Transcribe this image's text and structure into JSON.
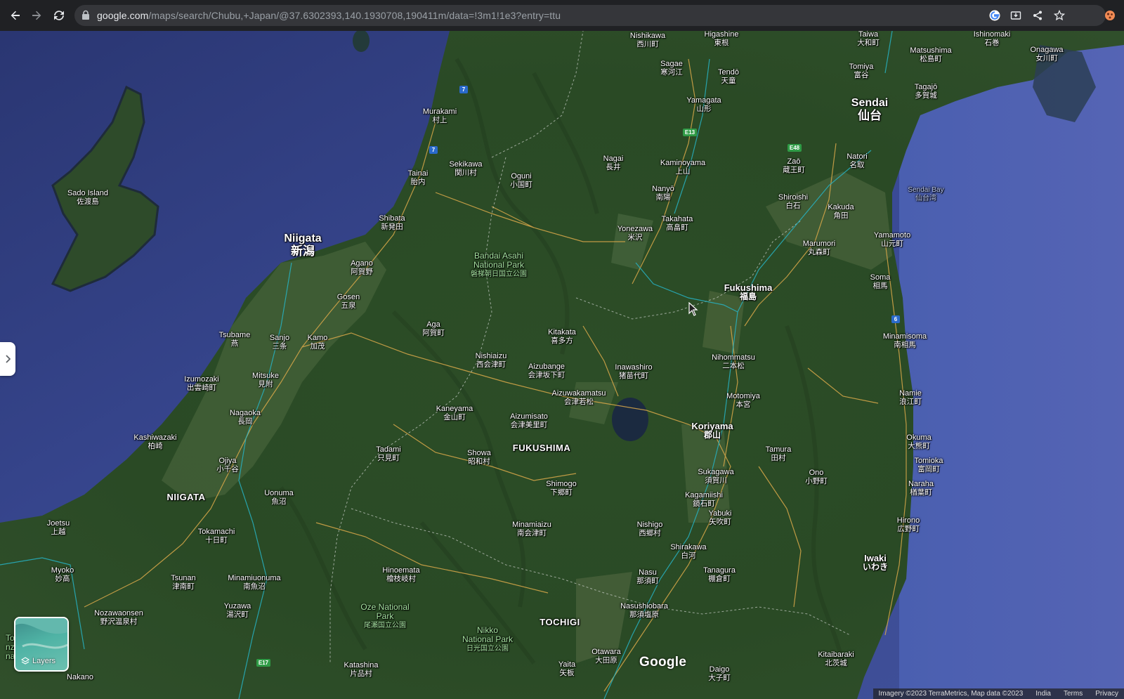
{
  "browser": {
    "url_host": "google.com",
    "url_path": "/maps/search/Chubu,+Japan/@37.6302393,140.1930708,190411m/data=!3m1!1e3?entry=ttu",
    "icons": [
      "back-arrow-icon",
      "forward-arrow-icon",
      "reload-icon",
      "lock-icon",
      "google-g-icon",
      "install-app-icon",
      "share-icon",
      "bookmark-star-icon",
      "extension-icon"
    ]
  },
  "map": {
    "cities": [
      {
        "id": "niigata",
        "en": "Niigata",
        "jp": "新潟"
      },
      {
        "id": "sendai",
        "en": "Sendai",
        "jp": "仙台"
      },
      {
        "id": "fukushima",
        "en": "Fukushima",
        "jp": "福島"
      },
      {
        "id": "koriyama",
        "en": "Koriyama",
        "jp": "郡山"
      },
      {
        "id": "iwaki",
        "en": "Iwaki",
        "jp": "いわき"
      }
    ],
    "towns": [
      {
        "en": "Nishikawa",
        "jp": "西川町"
      },
      {
        "en": "Higashine",
        "jp": "東根"
      },
      {
        "en": "Sagae",
        "jp": "寒河江"
      },
      {
        "en": "Tendō",
        "jp": "天童"
      },
      {
        "en": "Yamagata",
        "jp": "山形"
      },
      {
        "en": "Matsushima",
        "jp": "松島町"
      },
      {
        "en": "Onagawa",
        "jp": "女川町"
      },
      {
        "en": "Tomiya",
        "jp": "富谷"
      },
      {
        "en": "Tagajō",
        "jp": "多賀城"
      },
      {
        "en": "Taiwa",
        "jp": "大和町"
      },
      {
        "en": "Ishinomaki",
        "jp": "石巻"
      },
      {
        "en": "Murakami",
        "jp": "村上"
      },
      {
        "en": "Sekikawa",
        "jp": "関川村"
      },
      {
        "en": "Tainai",
        "jp": "胎内"
      },
      {
        "en": "Oguni",
        "jp": "小国町"
      },
      {
        "en": "Nagai",
        "jp": "長井"
      },
      {
        "en": "Kaminoyama",
        "jp": "上山"
      },
      {
        "en": "Zaō",
        "jp": "蔵王町"
      },
      {
        "en": "Natori",
        "jp": "名取"
      },
      {
        "en": "Nanyō",
        "jp": "南陽"
      },
      {
        "en": "Shiroishi",
        "jp": "白石"
      },
      {
        "en": "Kakuda",
        "jp": "角田"
      },
      {
        "en": "Sado Island",
        "jp": "佐渡島"
      },
      {
        "en": "Shibata",
        "jp": "新発田"
      },
      {
        "en": "Takahata",
        "jp": "高畠町"
      },
      {
        "en": "Yonezawa",
        "jp": "米沢"
      },
      {
        "en": "Yamamoto",
        "jp": "山元町"
      },
      {
        "en": "Marumori",
        "jp": "丸森町"
      },
      {
        "en": "Agano",
        "jp": "阿賀野"
      },
      {
        "en": "Soma",
        "jp": "相馬"
      },
      {
        "en": "Gosen",
        "jp": "五泉"
      },
      {
        "en": "Aga",
        "jp": "阿賀町"
      },
      {
        "en": "Kitakata",
        "jp": "喜多方"
      },
      {
        "en": "Tsubame",
        "jp": "燕"
      },
      {
        "en": "Sanjo",
        "jp": "三条"
      },
      {
        "en": "Kamo",
        "jp": "加茂"
      },
      {
        "en": "Minamisoma",
        "jp": "南相馬"
      },
      {
        "en": "Nishiaizu",
        "jp": "西会津町"
      },
      {
        "en": "Aizubange",
        "jp": "会津坂下町"
      },
      {
        "en": "Inawashiro",
        "jp": "猪苗代町"
      },
      {
        "en": "Nihommatsu",
        "jp": "二本松"
      },
      {
        "en": "Izumozaki",
        "jp": "出雲崎町"
      },
      {
        "en": "Mitsuke",
        "jp": "見附"
      },
      {
        "en": "Aizuwakamatsu",
        "jp": "会津若松"
      },
      {
        "en": "Motomiya",
        "jp": "本宮"
      },
      {
        "en": "Namie",
        "jp": "浪江町"
      },
      {
        "en": "Nagaoka",
        "jp": "長岡"
      },
      {
        "en": "Kaneyama",
        "jp": "金山町"
      },
      {
        "en": "Aizumisato",
        "jp": "会津美里町"
      },
      {
        "en": "Kashiwazaki",
        "jp": "柏崎"
      },
      {
        "en": "Tadami",
        "jp": "只見町"
      },
      {
        "en": "Tamura",
        "jp": "田村"
      },
      {
        "en": "Okuma",
        "jp": "大熊町"
      },
      {
        "en": "Ojiya",
        "jp": "小千谷"
      },
      {
        "en": "Showa",
        "jp": "昭和村"
      },
      {
        "en": "Tomioka",
        "jp": "富岡町"
      },
      {
        "en": "Sukagawa",
        "jp": "須賀川"
      },
      {
        "en": "Ono",
        "jp": "小野町"
      },
      {
        "en": "Uonuma",
        "jp": "魚沼"
      },
      {
        "en": "Shimogo",
        "jp": "下郷町"
      },
      {
        "en": "Naraha",
        "jp": "楢葉町"
      },
      {
        "en": "Kagamiishi",
        "jp": "鏡石町"
      },
      {
        "en": "Yabuki",
        "jp": "矢吹町"
      },
      {
        "en": "Joetsu",
        "jp": "上越"
      },
      {
        "en": "Tokamachi",
        "jp": "十日町"
      },
      {
        "en": "Minamiaizu",
        "jp": "南会津町"
      },
      {
        "en": "Nishigo",
        "jp": "西郷村"
      },
      {
        "en": "Hirono",
        "jp": "広野町"
      },
      {
        "en": "Shirakawa",
        "jp": "白河"
      },
      {
        "en": "Myoko",
        "jp": "妙高"
      },
      {
        "en": "Hinoemata",
        "jp": "檜枝岐村"
      },
      {
        "en": "Tsunan",
        "jp": "津南町"
      },
      {
        "en": "Minamiuonuma",
        "jp": "南魚沼"
      },
      {
        "en": "Nasu",
        "jp": "那須町"
      },
      {
        "en": "Tanagura",
        "jp": "棚倉町"
      },
      {
        "en": "Nozawaonsen",
        "jp": "野沢温泉村"
      },
      {
        "en": "Yuzawa",
        "jp": "湯沢町"
      },
      {
        "en": "Nasushiobara",
        "jp": "那須塩原"
      },
      {
        "en": "Otawara",
        "jp": "大田原"
      },
      {
        "en": "Kitaibaraki",
        "jp": "北茨城"
      },
      {
        "en": "Katashina",
        "jp": "片品村"
      },
      {
        "en": "Yaita",
        "jp": "矢板"
      },
      {
        "en": "Daigo",
        "jp": "大子町"
      },
      {
        "en": "Nakano",
        "jp": ""
      }
    ],
    "prefectures": [
      "NIIGATA",
      "FUKUSHIMA",
      "TOCHIGI"
    ],
    "parks": [
      {
        "en1": "Bandai Asahi",
        "en2": "National Park",
        "jp": "磐梯朝日国立公園"
      },
      {
        "en1": "Oze National",
        "en2": "Park",
        "jp": "尾瀬国立公園"
      },
      {
        "en1": "Nikko",
        "en2": "National Park",
        "jp": "日光国立公園"
      }
    ],
    "water": [
      {
        "en": "Sendai Bay",
        "jp": "仙台湾"
      }
    ],
    "road_shields": [
      "7",
      "7",
      "E13",
      "E48",
      "6",
      "E17"
    ],
    "partial_label": "Toc\nnza\nnal",
    "watermark": "© 2023 Google"
  },
  "controls": {
    "layers_label": "Layers",
    "google_logo": "Google",
    "footer": [
      "Imagery ©2023 TerraMetrics, Map data ©2023",
      "India",
      "Terms",
      "Privacy"
    ]
  },
  "colors": {
    "sea": "#3a4a8f",
    "land": "#2f4d28",
    "road": "#d9a84a",
    "rail": "#27b3c4",
    "chrome": "#202124",
    "omnibox": "#35363a"
  }
}
